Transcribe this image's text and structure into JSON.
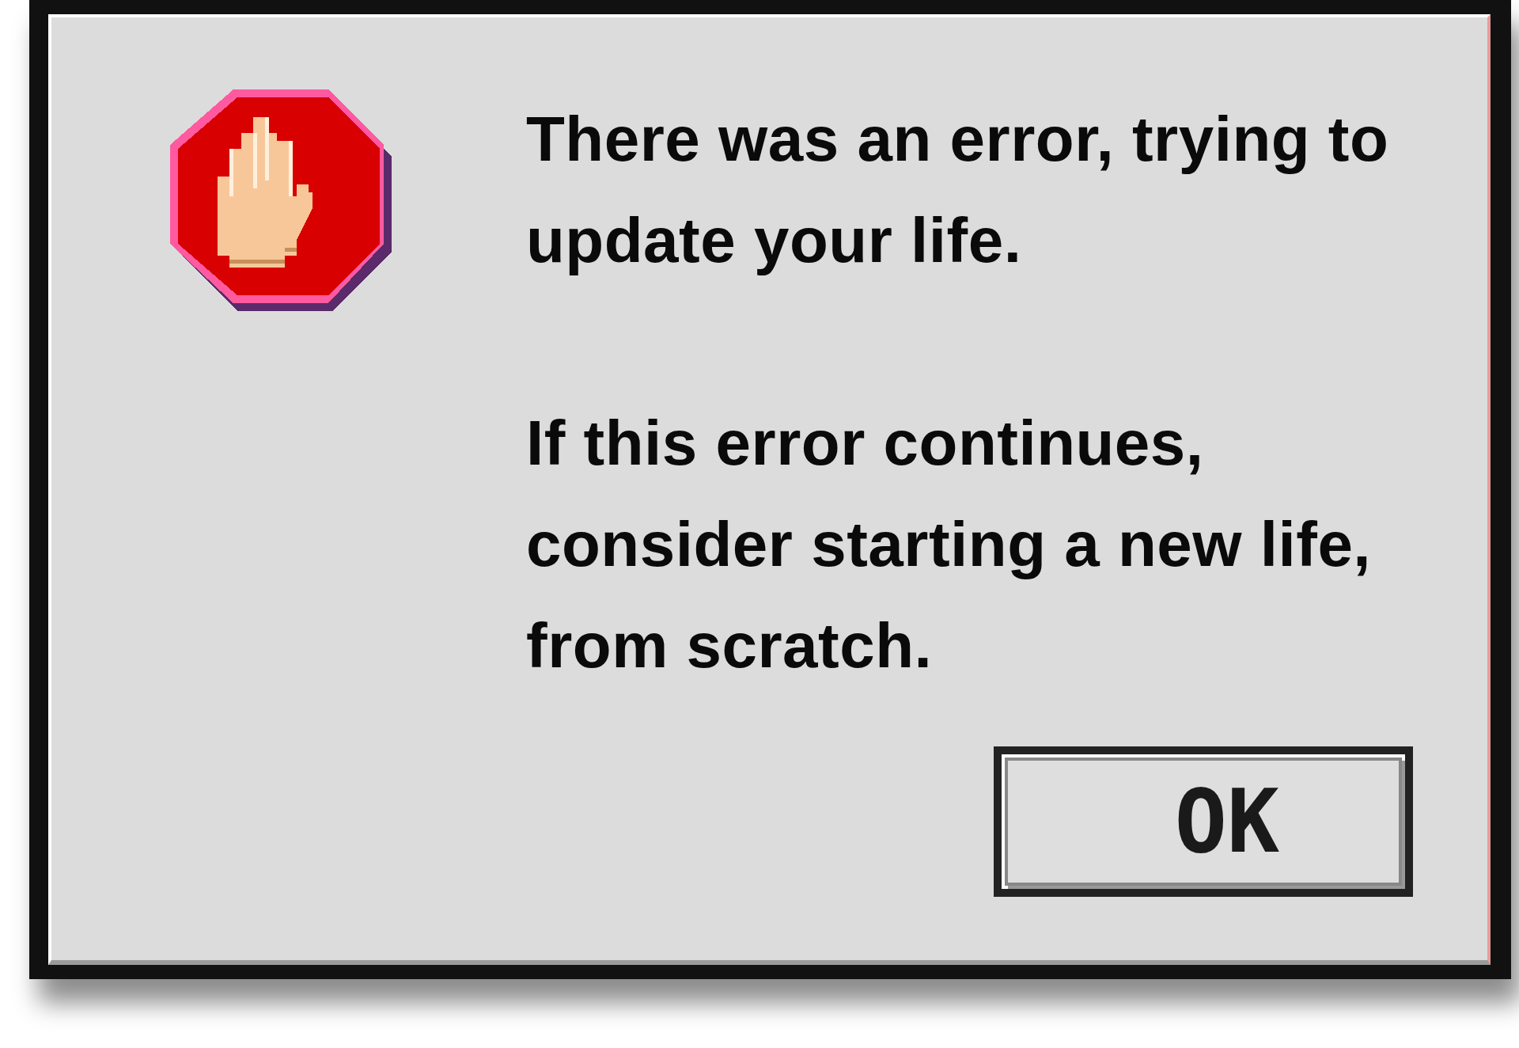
{
  "dialog": {
    "kind": "stop",
    "messages": [
      "There was an error, trying to update your life.",
      "If this error continues, consider starting a new life, from scratch."
    ],
    "buttons": [
      "OK"
    ]
  }
}
